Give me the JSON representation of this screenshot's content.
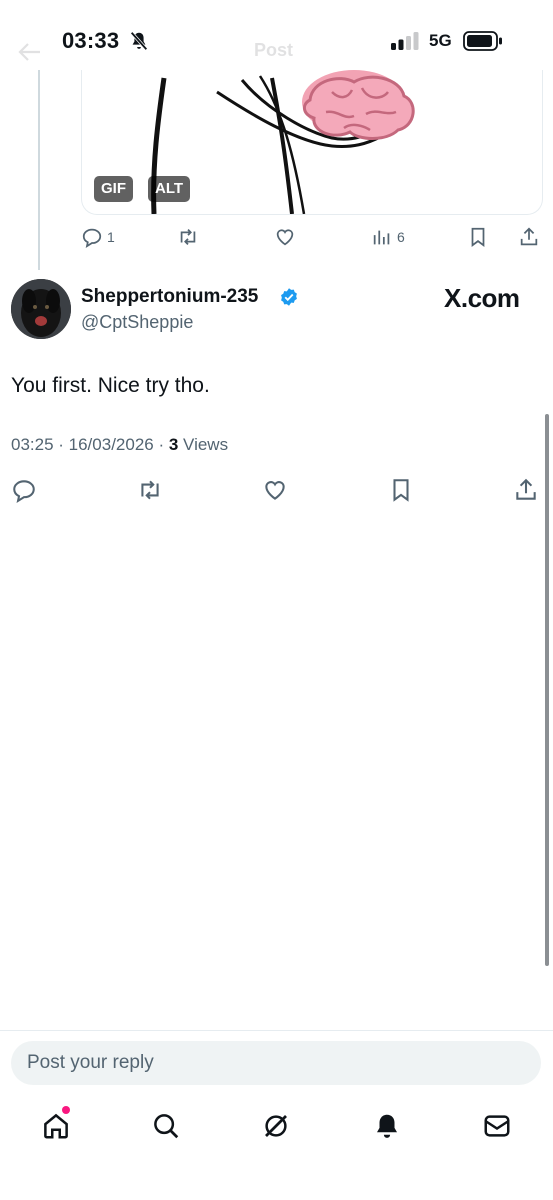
{
  "status_bar": {
    "time": "03:33",
    "network": "5G"
  },
  "header": {
    "title": "Post"
  },
  "parent_post": {
    "media_badges": [
      "GIF",
      "ALT"
    ],
    "actions": {
      "replies": "1",
      "views": "6"
    }
  },
  "main_post": {
    "author_name": "Sheppertonium-235",
    "author_handle": "@CptSheppie",
    "source_label": "X.com",
    "text": "You first. Nice try tho.",
    "timestamp": "03:25 · 16/03/2026 · ",
    "views_count": "3",
    "views_label": " Views"
  },
  "reply": {
    "placeholder": "Post your reply"
  },
  "bottom_nav": {
    "items": [
      "home-icon",
      "search-icon",
      "grok-icon",
      "notifications-icon",
      "messages-icon"
    ],
    "badge_color": "#f91880"
  },
  "colors": {
    "secondary_text": "#536471",
    "verified": "#1d9bf0"
  }
}
